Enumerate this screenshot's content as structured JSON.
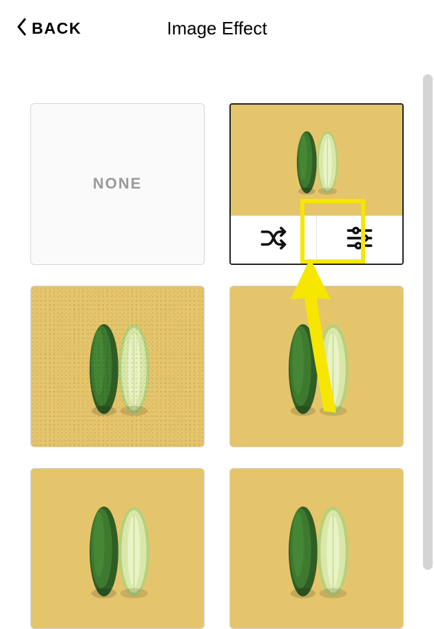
{
  "header": {
    "back_label": "BACK",
    "title": "Image Effect"
  },
  "tiles": {
    "none_label": "NONE"
  },
  "colors": {
    "bg_warm": "#e5c56b",
    "highlight": "#f7e600"
  }
}
